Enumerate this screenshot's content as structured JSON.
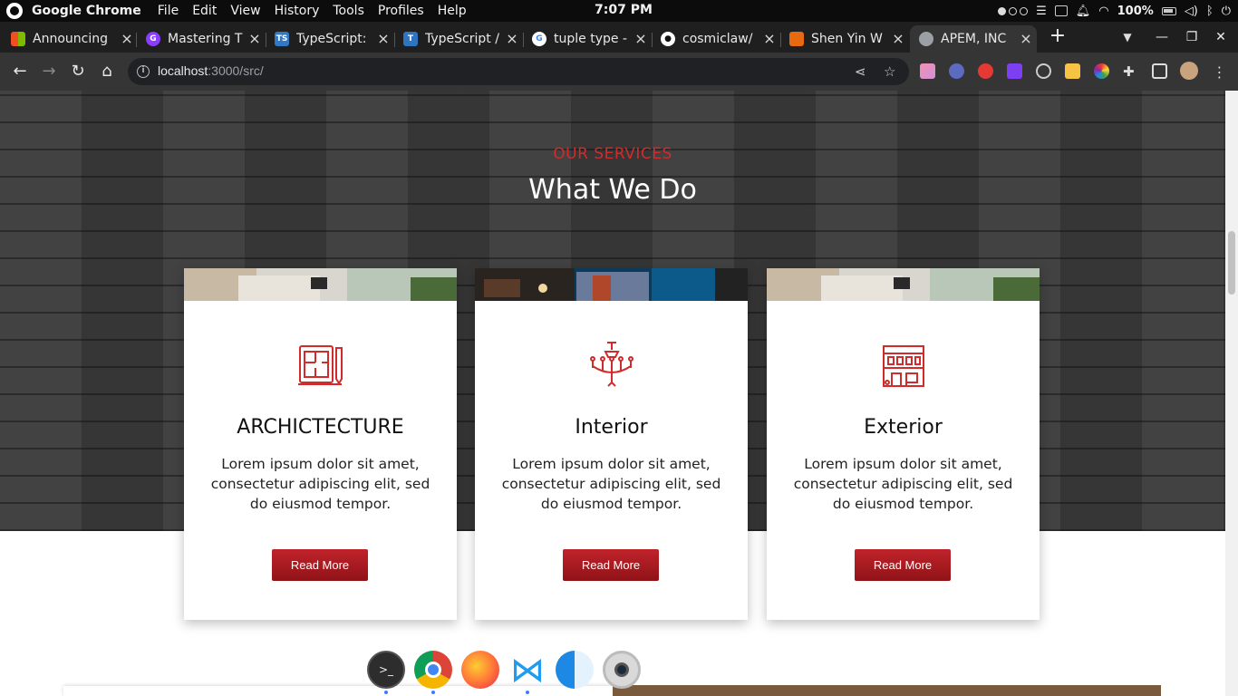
{
  "os_bar": {
    "app_name": "Google Chrome",
    "menu": [
      "File",
      "Edit",
      "View",
      "History",
      "Tools",
      "Profiles",
      "Help"
    ],
    "clock": "7:07 PM",
    "battery_percent": "100%"
  },
  "tabs": [
    {
      "title": "Announcing",
      "icon": "microsoft-logo-icon",
      "color": "#f25022"
    },
    {
      "title": "Mastering T",
      "icon": "gumroad-icon",
      "color": "#8b3dff"
    },
    {
      "title": "TypeScript:",
      "icon": "typescript-icon",
      "color": "#3178c6"
    },
    {
      "title": "TypeScript /",
      "icon": "typescript-icon",
      "color": "#2f74c0"
    },
    {
      "title": "tuple type -",
      "icon": "google-icon",
      "color": "#ffffff"
    },
    {
      "title": "cosmiclaw/",
      "icon": "github-icon",
      "color": "#ffffff"
    },
    {
      "title": "Shen Yin W",
      "icon": "bookmark-site-icon",
      "color": "#e86a10"
    },
    {
      "title": "APEM, INC",
      "icon": "globe-icon",
      "color": "#9aa0a6"
    }
  ],
  "address_bar": {
    "host": "localhost",
    "rest": ":3000/src/"
  },
  "services": {
    "eyebrow": "OUR SERVICES",
    "title": "What We Do",
    "cards": [
      {
        "title": "ARCHICTECTURE",
        "text": "Lorem ipsum dolor sit amet, consectetur adipiscing elit, sed do eiusmod tempor.",
        "button": "Read More",
        "icon": "blueprint-icon"
      },
      {
        "title": "Interior",
        "text": "Lorem ipsum dolor sit amet, consectetur adipiscing elit, sed do eiusmod tempor.",
        "button": "Read More",
        "icon": "chandelier-icon"
      },
      {
        "title": "Exterior",
        "text": "Lorem ipsum dolor sit amet, consectetur adipiscing elit, sed do eiusmod tempor.",
        "button": "Read More",
        "icon": "building-icon"
      }
    ]
  },
  "colors": {
    "accent_red": "#d12c2c",
    "button_red": "#b01e25",
    "browser_dark": "#353535"
  },
  "dock": [
    "terminal-icon",
    "chrome-icon",
    "firefox-icon",
    "vscode-icon",
    "finder-icon",
    "camera-icon"
  ]
}
